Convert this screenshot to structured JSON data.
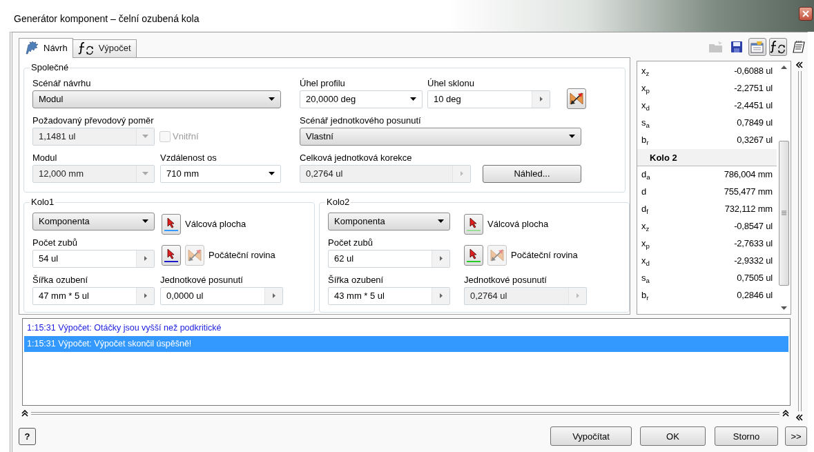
{
  "window": {
    "title": "Generátor komponent – čelní ozubená kola"
  },
  "tabs": [
    {
      "label": "Návrh",
      "selected": true
    },
    {
      "label": "Výpočet",
      "selected": false
    }
  ],
  "toolbar": [
    {
      "disabled": true,
      "pressed": false
    },
    {
      "disabled": false,
      "pressed": false
    },
    {
      "disabled": false,
      "pressed": true
    },
    {
      "disabled": false,
      "pressed": true
    },
    {
      "disabled": false,
      "pressed": false
    }
  ],
  "common": {
    "title": "Společné",
    "design_scenario": {
      "label": "Scénář návrhu",
      "value": "Modul",
      "kind": "dropdown",
      "disabled": false
    },
    "gear_ratio": {
      "label": "Požadovaný převodový poměr",
      "value": "1,1481 ul",
      "kind": "combo",
      "disabled": true
    },
    "internal": {
      "label": "Vnitřní",
      "checked": false,
      "disabled": true
    },
    "module": {
      "label": "Modul",
      "value": "12,000 mm",
      "kind": "combo",
      "disabled": true
    },
    "center_distance": {
      "label": "Vzdálenost os",
      "value": "710 mm",
      "kind": "combo",
      "disabled": false
    },
    "pressure_angle": {
      "label": "Úhel profilu",
      "value": "20,0000 deg",
      "kind": "combo",
      "disabled": false
    },
    "helix_angle": {
      "label": "Úhel sklonu",
      "value": "10 deg",
      "kind": "spin",
      "disabled": false
    },
    "shift_scenario": {
      "label": "Scénář jednotkového posunutí",
      "value": "Vlastní",
      "kind": "dropdown",
      "disabled": false
    },
    "total_correction": {
      "label": "Celková jednotková korekce",
      "value": "0,2764 ul",
      "kind": "spin",
      "disabled": true
    },
    "preview_button": "Náhled..."
  },
  "gears": [
    {
      "title": "Kolo1",
      "component": {
        "value": "Komponenta",
        "kind": "dropdown",
        "disabled": false
      },
      "cylinder": {
        "label": "Válcová plocha",
        "color": "#3399ff"
      },
      "plane": {
        "label": "Počáteční rovina",
        "color": "#1a1acc",
        "disabled": true
      },
      "teeth": {
        "label": "Počet zubů",
        "value": "54 ul",
        "kind": "spin",
        "disabled": false
      },
      "width": {
        "label": "Šířka ozubení",
        "value": "47 mm * 5 ul",
        "kind": "spin",
        "disabled": false
      },
      "shift": {
        "label": "Jednotkové posunutí",
        "value": "0,0000 ul",
        "kind": "spin",
        "disabled": false
      }
    },
    {
      "title": "Kolo2",
      "component": {
        "value": "Komponenta",
        "kind": "dropdown",
        "disabled": false
      },
      "cylinder": {
        "label": "Válcová plocha",
        "color": "#99dd99"
      },
      "plane": {
        "label": "Počáteční rovina",
        "color": "#22cc22",
        "disabled": true
      },
      "teeth": {
        "label": "Počet zubů",
        "value": "62 ul",
        "kind": "spin",
        "disabled": false
      },
      "width": {
        "label": "Šířka ozubení",
        "value": "43 mm * 5 ul",
        "kind": "spin",
        "disabled": false
      },
      "shift": {
        "label": "Jednotkové posunutí",
        "value": "0,2764 ul",
        "kind": "spin",
        "disabled": true
      }
    }
  ],
  "results": [
    {
      "kind": "row",
      "symbol": "x$_{z}$",
      "value": "-0,6088 ul"
    },
    {
      "kind": "row",
      "symbol": "x$_{p}$",
      "value": "-2,2751 ul"
    },
    {
      "kind": "row",
      "symbol": "x$_{d}$",
      "value": "-2,4451 ul"
    },
    {
      "kind": "row",
      "symbol": "s$_{a}$",
      "value": "0,7849 ul"
    },
    {
      "kind": "row",
      "symbol": "b$_{r}$",
      "value": "0,3267 ul"
    },
    {
      "kind": "header",
      "symbol": "Kolo 2"
    },
    {
      "kind": "row",
      "symbol": "d$_{a}$",
      "value": "786,004 mm"
    },
    {
      "kind": "row",
      "symbol": "d",
      "value": "755,477 mm"
    },
    {
      "kind": "row",
      "symbol": "d$_{f}$",
      "value": "732,112 mm"
    },
    {
      "kind": "row",
      "symbol": "x$_{z}$",
      "value": "-0,8547 ul"
    },
    {
      "kind": "row",
      "symbol": "x$_{p}$",
      "value": "-2,7633 ul"
    },
    {
      "kind": "row",
      "symbol": "x$_{d}$",
      "value": "-2,9332 ul"
    },
    {
      "kind": "row",
      "symbol": "s$_{a}$",
      "value": "0,7505 ul"
    },
    {
      "kind": "row",
      "symbol": "b$_{r}$",
      "value": "0,2846 ul"
    }
  ],
  "log": [
    {
      "text": "1:15:31 Výpočet: Otáčky jsou vyšší než podkritické",
      "kind": "warning",
      "selected": false
    },
    {
      "text": "1:15:31 Výpočet: Výpočet skončil úspěšně!",
      "kind": "info",
      "selected": true
    }
  ],
  "buttons": {
    "help": "?",
    "calculate": "Vypočítat",
    "ok": "OK",
    "cancel": "Storno",
    "more": ">>"
  }
}
